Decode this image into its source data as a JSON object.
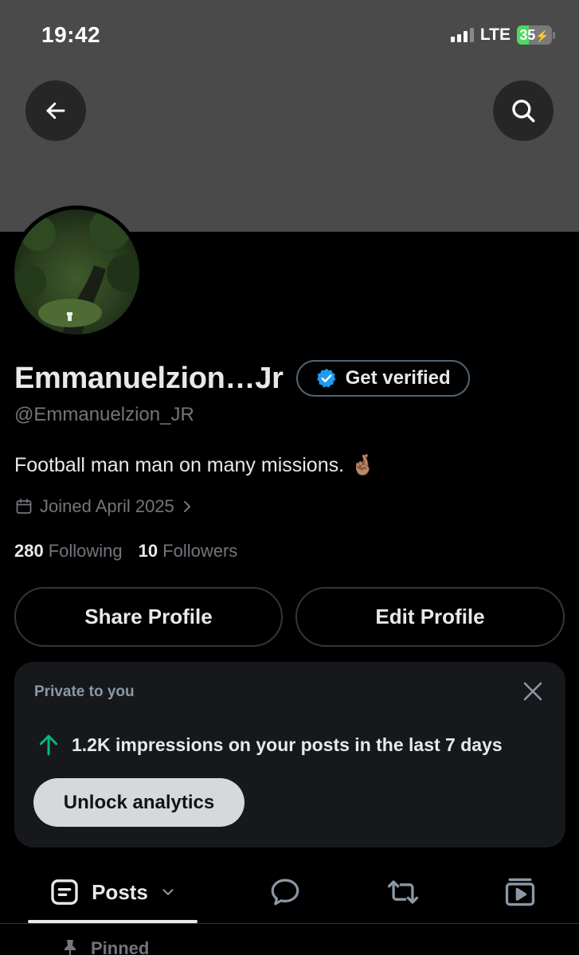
{
  "status_bar": {
    "time": "19:42",
    "network": "LTE",
    "battery_level": "35",
    "battery_fraction": 0.35,
    "charging": true
  },
  "header": {
    "back_icon": "arrow-left-icon",
    "search_icon": "search-icon",
    "banner_color": "#4a4a4a"
  },
  "profile": {
    "display_name": "Emmanuelzion…Jr",
    "verify_label": "Get verified",
    "handle": "@Emmanuelzion_JR",
    "bio": "Football man man on many missions.",
    "bio_emoji": "🤞🏽",
    "joined": "Joined April 2025",
    "following_count": "280",
    "following_label": "Following",
    "followers_count": "10",
    "followers_label": "Followers"
  },
  "actions": {
    "share_label": "Share Profile",
    "edit_label": "Edit Profile"
  },
  "analytics_card": {
    "label": "Private to you",
    "impressions_text": "1.2K impressions on your posts in the last 7 days",
    "unlock_label": "Unlock analytics"
  },
  "tabs": {
    "posts_label": "Posts",
    "items": [
      "posts-icon",
      "replies-icon",
      "reposts-icon",
      "media-icon"
    ]
  },
  "pinned": {
    "label": "Pinned"
  },
  "colors": {
    "background": "#000000",
    "verified_blue": "#1d9bf0",
    "up_arrow_green": "#00ba7c",
    "muted_text": "#71767b"
  }
}
